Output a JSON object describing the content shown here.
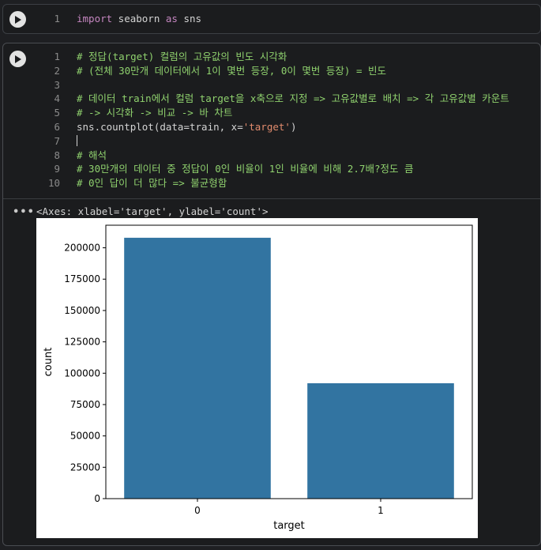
{
  "cell1": {
    "line_number": "1",
    "tokens": {
      "kw_import": "import",
      "mod": " seaborn ",
      "kw_as": "as",
      "alias": " sns"
    }
  },
  "cell2": {
    "lines": [
      {
        "n": "1",
        "type": "comment",
        "text": "# 정답(target) 컬럼의 고유값의 빈도 시각화"
      },
      {
        "n": "2",
        "type": "comment",
        "text": "# (전체 30만개 데이터에서 1이 몇번 등장, 0이 몇번 등장) = 빈도"
      },
      {
        "n": "3",
        "type": "empty",
        "text": ""
      },
      {
        "n": "4",
        "type": "comment",
        "text": "# 데이터 train에서 컬럼 target을 x축으로 지정 => 고유값별로 배치 => 각 고유값별 카운트"
      },
      {
        "n": "5",
        "type": "comment",
        "text": "# -> 시각화 -> 비교 -> 바 차트"
      },
      {
        "n": "6",
        "type": "code",
        "pre": "sns.countplot(data=train, x=",
        "str": "'target'",
        "post": ")"
      },
      {
        "n": "7",
        "type": "cursor",
        "text": ""
      },
      {
        "n": "8",
        "type": "comment",
        "text": "# 해석"
      },
      {
        "n": "9",
        "type": "comment",
        "text": "# 30만개의 데이터 중 정답이 0인 비율이 1인 비율에 비해 2.7배?정도 큼"
      },
      {
        "n": "10",
        "type": "comment",
        "text": "# 0인 답이 더 많다 => 불균형함"
      }
    ],
    "output_menu": "•••",
    "output_text": "<Axes: xlabel='target', ylabel='count'>"
  },
  "chart_data": {
    "type": "bar",
    "categories": [
      "0",
      "1"
    ],
    "values": [
      208000,
      92000
    ],
    "xlabel": "target",
    "ylabel": "count",
    "ylim": [
      0,
      218000
    ],
    "yticks": [
      0,
      25000,
      50000,
      75000,
      100000,
      125000,
      150000,
      175000,
      200000
    ],
    "bar_color": "#3274a1",
    "grid": false
  },
  "colors": {
    "background": "#1e1f22",
    "comment": "#8fd16e",
    "keyword": "#c586c0",
    "string": "#e28b6d"
  }
}
